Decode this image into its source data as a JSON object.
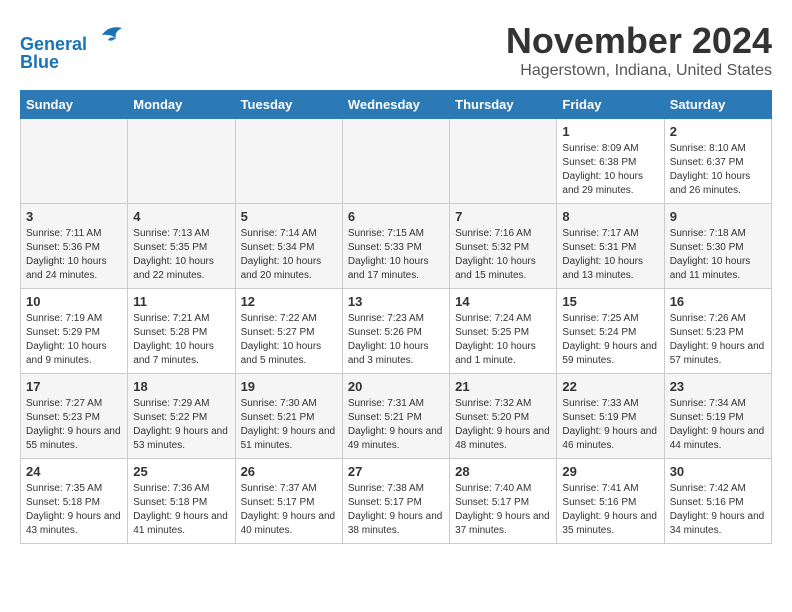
{
  "logo": {
    "line1": "General",
    "line2": "Blue"
  },
  "title": "November 2024",
  "location": "Hagerstown, Indiana, United States",
  "headers": [
    "Sunday",
    "Monday",
    "Tuesday",
    "Wednesday",
    "Thursday",
    "Friday",
    "Saturday"
  ],
  "weeks": [
    [
      {
        "day": "",
        "info": ""
      },
      {
        "day": "",
        "info": ""
      },
      {
        "day": "",
        "info": ""
      },
      {
        "day": "",
        "info": ""
      },
      {
        "day": "",
        "info": ""
      },
      {
        "day": "1",
        "info": "Sunrise: 8:09 AM\nSunset: 6:38 PM\nDaylight: 10 hours and 29 minutes."
      },
      {
        "day": "2",
        "info": "Sunrise: 8:10 AM\nSunset: 6:37 PM\nDaylight: 10 hours and 26 minutes."
      }
    ],
    [
      {
        "day": "3",
        "info": "Sunrise: 7:11 AM\nSunset: 5:36 PM\nDaylight: 10 hours and 24 minutes."
      },
      {
        "day": "4",
        "info": "Sunrise: 7:13 AM\nSunset: 5:35 PM\nDaylight: 10 hours and 22 minutes."
      },
      {
        "day": "5",
        "info": "Sunrise: 7:14 AM\nSunset: 5:34 PM\nDaylight: 10 hours and 20 minutes."
      },
      {
        "day": "6",
        "info": "Sunrise: 7:15 AM\nSunset: 5:33 PM\nDaylight: 10 hours and 17 minutes."
      },
      {
        "day": "7",
        "info": "Sunrise: 7:16 AM\nSunset: 5:32 PM\nDaylight: 10 hours and 15 minutes."
      },
      {
        "day": "8",
        "info": "Sunrise: 7:17 AM\nSunset: 5:31 PM\nDaylight: 10 hours and 13 minutes."
      },
      {
        "day": "9",
        "info": "Sunrise: 7:18 AM\nSunset: 5:30 PM\nDaylight: 10 hours and 11 minutes."
      }
    ],
    [
      {
        "day": "10",
        "info": "Sunrise: 7:19 AM\nSunset: 5:29 PM\nDaylight: 10 hours and 9 minutes."
      },
      {
        "day": "11",
        "info": "Sunrise: 7:21 AM\nSunset: 5:28 PM\nDaylight: 10 hours and 7 minutes."
      },
      {
        "day": "12",
        "info": "Sunrise: 7:22 AM\nSunset: 5:27 PM\nDaylight: 10 hours and 5 minutes."
      },
      {
        "day": "13",
        "info": "Sunrise: 7:23 AM\nSunset: 5:26 PM\nDaylight: 10 hours and 3 minutes."
      },
      {
        "day": "14",
        "info": "Sunrise: 7:24 AM\nSunset: 5:25 PM\nDaylight: 10 hours and 1 minute."
      },
      {
        "day": "15",
        "info": "Sunrise: 7:25 AM\nSunset: 5:24 PM\nDaylight: 9 hours and 59 minutes."
      },
      {
        "day": "16",
        "info": "Sunrise: 7:26 AM\nSunset: 5:23 PM\nDaylight: 9 hours and 57 minutes."
      }
    ],
    [
      {
        "day": "17",
        "info": "Sunrise: 7:27 AM\nSunset: 5:23 PM\nDaylight: 9 hours and 55 minutes."
      },
      {
        "day": "18",
        "info": "Sunrise: 7:29 AM\nSunset: 5:22 PM\nDaylight: 9 hours and 53 minutes."
      },
      {
        "day": "19",
        "info": "Sunrise: 7:30 AM\nSunset: 5:21 PM\nDaylight: 9 hours and 51 minutes."
      },
      {
        "day": "20",
        "info": "Sunrise: 7:31 AM\nSunset: 5:21 PM\nDaylight: 9 hours and 49 minutes."
      },
      {
        "day": "21",
        "info": "Sunrise: 7:32 AM\nSunset: 5:20 PM\nDaylight: 9 hours and 48 minutes."
      },
      {
        "day": "22",
        "info": "Sunrise: 7:33 AM\nSunset: 5:19 PM\nDaylight: 9 hours and 46 minutes."
      },
      {
        "day": "23",
        "info": "Sunrise: 7:34 AM\nSunset: 5:19 PM\nDaylight: 9 hours and 44 minutes."
      }
    ],
    [
      {
        "day": "24",
        "info": "Sunrise: 7:35 AM\nSunset: 5:18 PM\nDaylight: 9 hours and 43 minutes."
      },
      {
        "day": "25",
        "info": "Sunrise: 7:36 AM\nSunset: 5:18 PM\nDaylight: 9 hours and 41 minutes."
      },
      {
        "day": "26",
        "info": "Sunrise: 7:37 AM\nSunset: 5:17 PM\nDaylight: 9 hours and 40 minutes."
      },
      {
        "day": "27",
        "info": "Sunrise: 7:38 AM\nSunset: 5:17 PM\nDaylight: 9 hours and 38 minutes."
      },
      {
        "day": "28",
        "info": "Sunrise: 7:40 AM\nSunset: 5:17 PM\nDaylight: 9 hours and 37 minutes."
      },
      {
        "day": "29",
        "info": "Sunrise: 7:41 AM\nSunset: 5:16 PM\nDaylight: 9 hours and 35 minutes."
      },
      {
        "day": "30",
        "info": "Sunrise: 7:42 AM\nSunset: 5:16 PM\nDaylight: 9 hours and 34 minutes."
      }
    ]
  ]
}
